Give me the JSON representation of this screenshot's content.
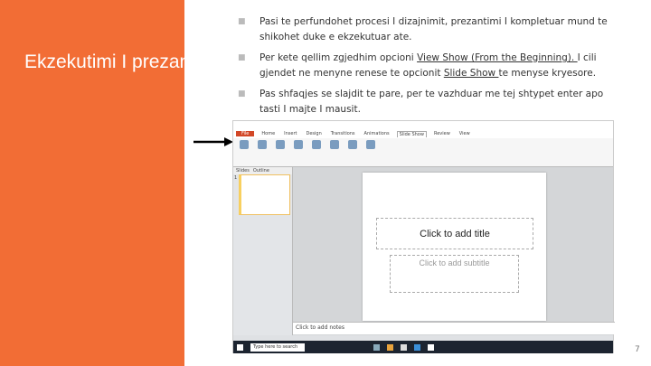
{
  "slide_title": "Ekzekutimi I prezantimit",
  "bullets": [
    {
      "text": "Pasi te perfundohet procesi I dizajnimit, prezantimi I kompletuar mund te shikohet duke e ekzekutuar ate."
    },
    {
      "pre": "Per kete qellim zgjedhim opcioni ",
      "link1": "View Show (From the Beginning). ",
      "mid": " I cili gjendet ne menyne renese te opcionit ",
      "link2": "Slide Show ",
      "post": "te menyse kryesore."
    },
    {
      "text": "Pas shfaqjes se slajdit te pare, per te vazhduar me tej shtypet enter apo tasti I majte I mausit."
    }
  ],
  "screenshot": {
    "tabs": [
      "File",
      "Home",
      "Insert",
      "Design",
      "Transitions",
      "Animations",
      "Slide Show",
      "Review",
      "View"
    ],
    "title_placeholder": "Click to add title",
    "subtitle_placeholder": "Click to add subtitle",
    "notes_placeholder": "Click to add notes",
    "panel_tabs": [
      "Slides",
      "Outline"
    ],
    "thumb_number": "1",
    "search_placeholder": "Type here to search"
  },
  "page_number": "7"
}
